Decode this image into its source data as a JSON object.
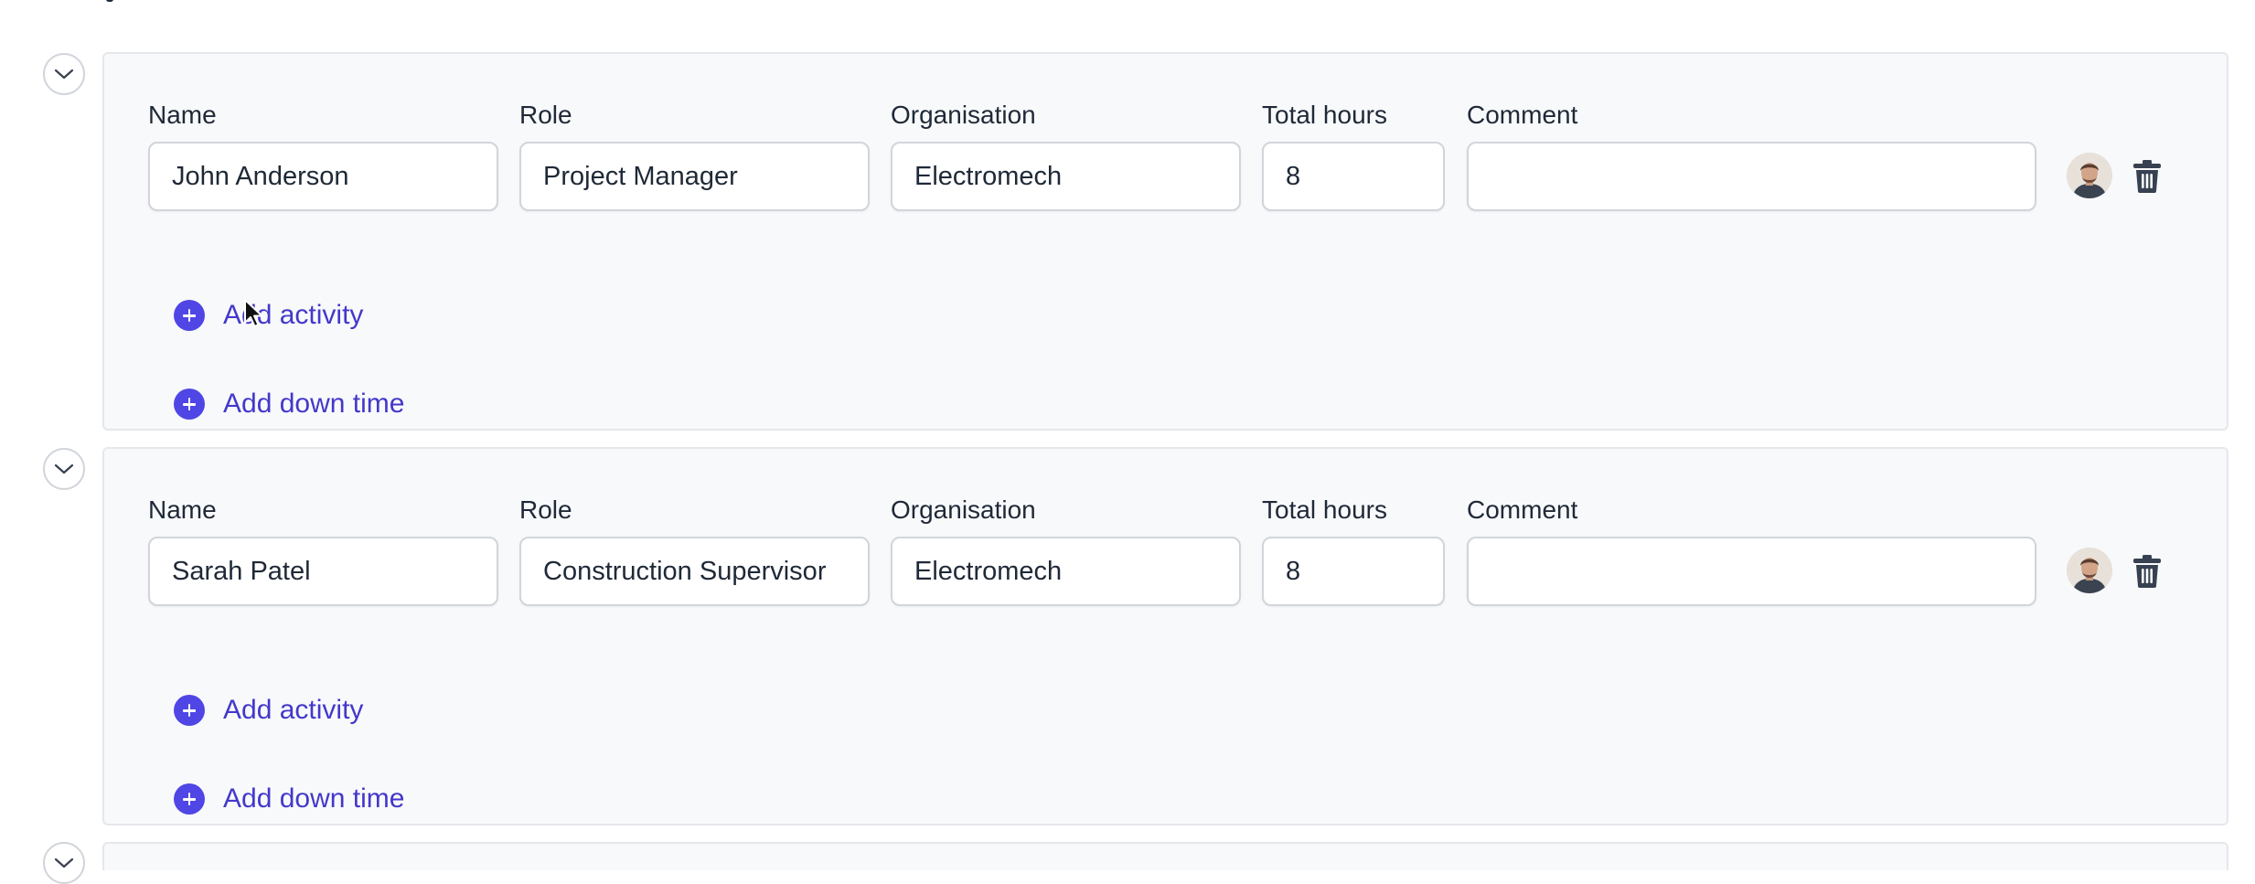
{
  "field_labels": {
    "name": "Name",
    "role": "Role",
    "organisation": "Organisation",
    "total_hours": "Total hours",
    "comment": "Comment"
  },
  "actions": {
    "add_activity": "Add activity",
    "add_down_time": "Add down time"
  },
  "entries": [
    {
      "name": "John Anderson",
      "role": "Project Manager",
      "organisation": "Electromech",
      "total_hours": "8",
      "comment": ""
    },
    {
      "name": "Sarah Patel",
      "role": "Construction Supervisor",
      "organisation": "Electromech",
      "total_hours": "8",
      "comment": ""
    }
  ],
  "icons": {
    "collapse": "chevron-down-icon",
    "add": "plus-circle-icon",
    "delete": "trash-icon",
    "user": "avatar"
  },
  "colors": {
    "accent": "#4f46e5",
    "link_text": "#4338ca",
    "card_background": "#f8f9fb",
    "card_border": "#e5e7eb",
    "input_border": "#d1d5db"
  }
}
